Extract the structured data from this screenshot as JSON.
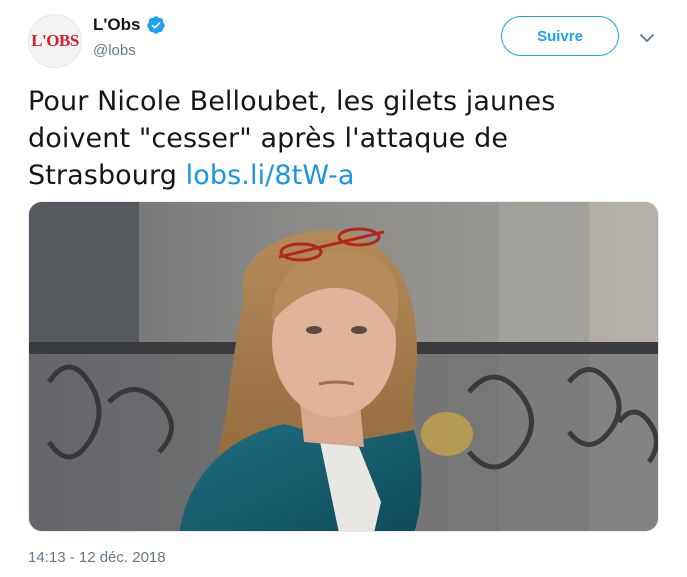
{
  "author": {
    "name": "L'Obs",
    "handle": "@lobs",
    "avatar_logo": "L'OBS",
    "verified": true
  },
  "follow_button": {
    "label": "Suivre"
  },
  "tweet": {
    "text": "Pour Nicole Belloubet, les gilets jaunes doivent \"cesser\" après l'attaque de Strasbourg ",
    "link": "lobs.li/8tW-a"
  },
  "timestamp": "14:13 - 12 déc. 2018",
  "colors": {
    "accent": "#1da1f2",
    "link": "#1b95e0",
    "secondary_text": "#657786",
    "logo_red": "#d81e2a"
  },
  "icons": {
    "verified": "verified-badge-icon",
    "caret": "chevron-down-icon"
  }
}
